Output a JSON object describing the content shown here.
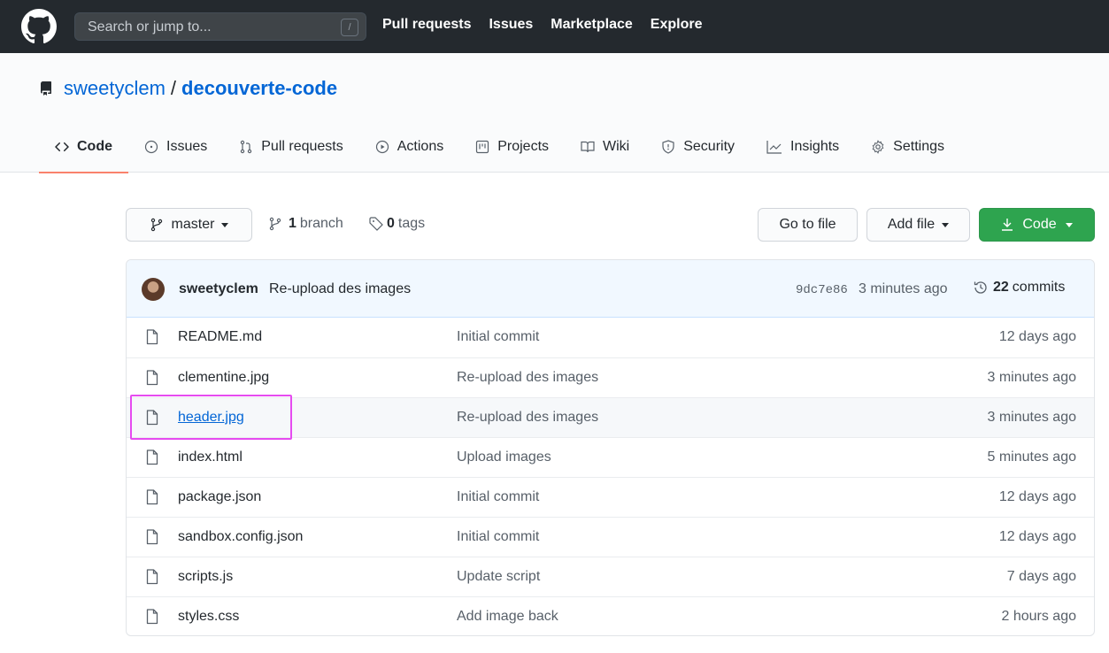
{
  "header": {
    "search_placeholder": "Search or jump to...",
    "search_shortcut": "/",
    "nav": [
      "Pull requests",
      "Issues",
      "Marketplace",
      "Explore"
    ]
  },
  "repo": {
    "owner": "sweetyclem",
    "separator": "/",
    "name": "decouverte-code"
  },
  "tabs": [
    {
      "label": "Code",
      "icon": "code-icon",
      "selected": true
    },
    {
      "label": "Issues",
      "icon": "issue-icon"
    },
    {
      "label": "Pull requests",
      "icon": "pull-request-icon"
    },
    {
      "label": "Actions",
      "icon": "play-icon"
    },
    {
      "label": "Projects",
      "icon": "project-icon"
    },
    {
      "label": "Wiki",
      "icon": "book-icon"
    },
    {
      "label": "Security",
      "icon": "shield-icon"
    },
    {
      "label": "Insights",
      "icon": "graph-icon"
    },
    {
      "label": "Settings",
      "icon": "gear-icon"
    }
  ],
  "branch_bar": {
    "branch": "master",
    "branch_count": "1",
    "branch_label": "branch",
    "tag_count": "0",
    "tag_label": "tags",
    "go_to_file": "Go to file",
    "add_file": "Add file",
    "code": "Code"
  },
  "latest_commit": {
    "author": "sweetyclem",
    "message": "Re-upload des images",
    "sha": "9dc7e86",
    "time": "3 minutes ago",
    "commit_count": "22",
    "commit_label": "commits"
  },
  "files": [
    {
      "name": "README.md",
      "message": "Initial commit",
      "age": "12 days ago"
    },
    {
      "name": "clementine.jpg",
      "message": "Re-upload des images",
      "age": "3 minutes ago"
    },
    {
      "name": "header.jpg",
      "message": "Re-upload des images",
      "age": "3 minutes ago"
    },
    {
      "name": "index.html",
      "message": "Upload images",
      "age": "5 minutes ago"
    },
    {
      "name": "package.json",
      "message": "Initial commit",
      "age": "12 days ago"
    },
    {
      "name": "sandbox.config.json",
      "message": "Initial commit",
      "age": "12 days ago"
    },
    {
      "name": "scripts.js",
      "message": "Update script",
      "age": "7 days ago"
    },
    {
      "name": "styles.css",
      "message": "Add image back",
      "age": "2 hours ago"
    }
  ],
  "highlight_color": "#e64bf0"
}
